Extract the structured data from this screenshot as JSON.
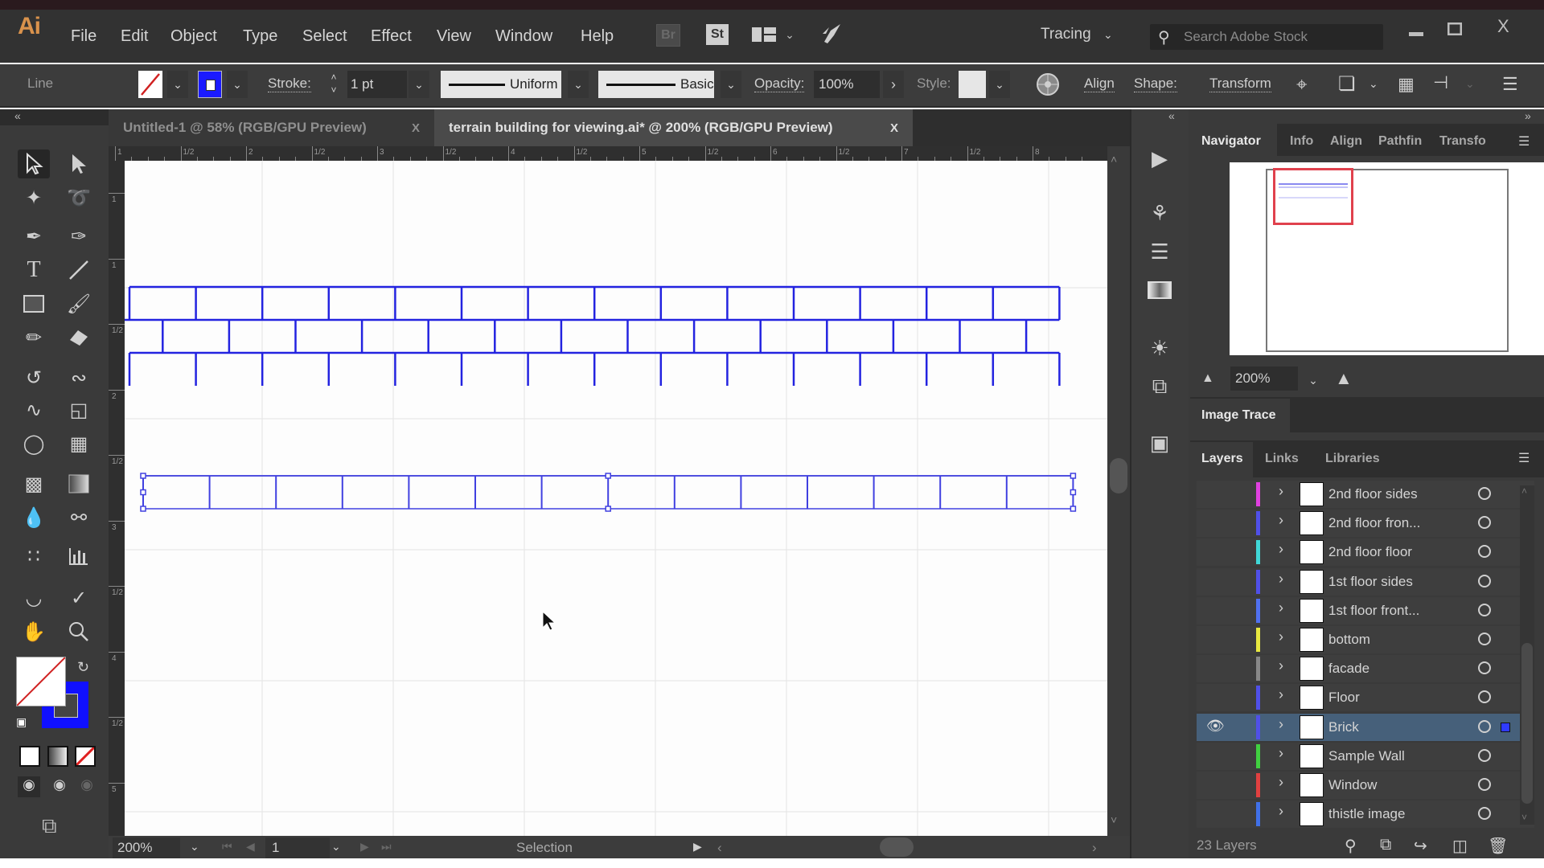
{
  "app": {
    "logo": "Ai",
    "menu": [
      "File",
      "Edit",
      "Object",
      "Type",
      "Select",
      "Effect",
      "View",
      "Window",
      "Help"
    ],
    "bridge_label": "Br",
    "stock_label": "St",
    "workspace": "Tracing",
    "search_placeholder": "Search Adobe Stock",
    "window_controls": {
      "minimize": "—",
      "maximize": "☐",
      "close": "X"
    }
  },
  "control_bar": {
    "selection_type": "Line",
    "stroke_label": "Stroke:",
    "stroke_weight": "1 pt",
    "profile_label": "Uniform",
    "brush_label": "Basic",
    "opacity_label": "Opacity:",
    "opacity_value": "100%",
    "style_label": "Style:",
    "align_label": "Align",
    "shape_label": "Shape:",
    "transform_label": "Transform",
    "colors": {
      "fill": "none",
      "stroke": "#0000ff"
    }
  },
  "tabs": [
    {
      "label": "Untitled-1 @ 58% (RGB/GPU Preview)",
      "close": "X",
      "active": false
    },
    {
      "label": "terrain building for viewing.ai* @ 200% (RGB/GPU Preview)",
      "close": "X",
      "active": true
    }
  ],
  "ruler": {
    "horizontal": [
      "1",
      "1/2",
      "2",
      "1/2",
      "3",
      "1/2",
      "4",
      "1/2",
      "5",
      "1/2",
      "6",
      "1/2",
      "7",
      "1/2",
      "8"
    ],
    "vertical": [
      "1",
      "1",
      "1/2",
      "2",
      "1/2",
      "3",
      "1/2",
      "4",
      "1/2",
      "5"
    ]
  },
  "artwork": {
    "stroke_color": "#2323e0",
    "brick_rows": 3,
    "bricks_per_row": 14,
    "lower_strip_cells": 14
  },
  "status_bar": {
    "zoom": "200%",
    "artboard": "1",
    "tool": "Selection"
  },
  "navigator": {
    "tabs": [
      "Navigator",
      "Info",
      "Align",
      "Pathfin",
      "Transfo"
    ],
    "zoom": "200%"
  },
  "image_trace": {
    "title": "Image Trace"
  },
  "layers": {
    "tabs": [
      "Layers",
      "Links",
      "Libraries"
    ],
    "items": [
      {
        "name": "2nd floor sides",
        "color": "#e040e0",
        "visible": false,
        "selected": false
      },
      {
        "name": "2nd floor fron...",
        "color": "#5050e8",
        "visible": false,
        "selected": false
      },
      {
        "name": "2nd floor floor",
        "color": "#40d8d8",
        "visible": false,
        "selected": false
      },
      {
        "name": "1st floor sides",
        "color": "#5050e8",
        "visible": false,
        "selected": false
      },
      {
        "name": "1st floor front...",
        "color": "#5070f0",
        "visible": false,
        "selected": false
      },
      {
        "name": "bottom",
        "color": "#e8e840",
        "visible": false,
        "selected": false
      },
      {
        "name": "facade",
        "color": "#888888",
        "visible": false,
        "selected": false
      },
      {
        "name": "Floor",
        "color": "#5050e8",
        "visible": false,
        "selected": false
      },
      {
        "name": "Brick",
        "color": "#5050e8",
        "visible": true,
        "selected": true
      },
      {
        "name": "Sample Wall",
        "color": "#40d040",
        "visible": false,
        "selected": false
      },
      {
        "name": "Window",
        "color": "#e04040",
        "visible": false,
        "selected": false
      },
      {
        "name": "thistle image",
        "color": "#4070e8",
        "visible": false,
        "selected": false
      }
    ],
    "count_label": "23 Layers"
  }
}
